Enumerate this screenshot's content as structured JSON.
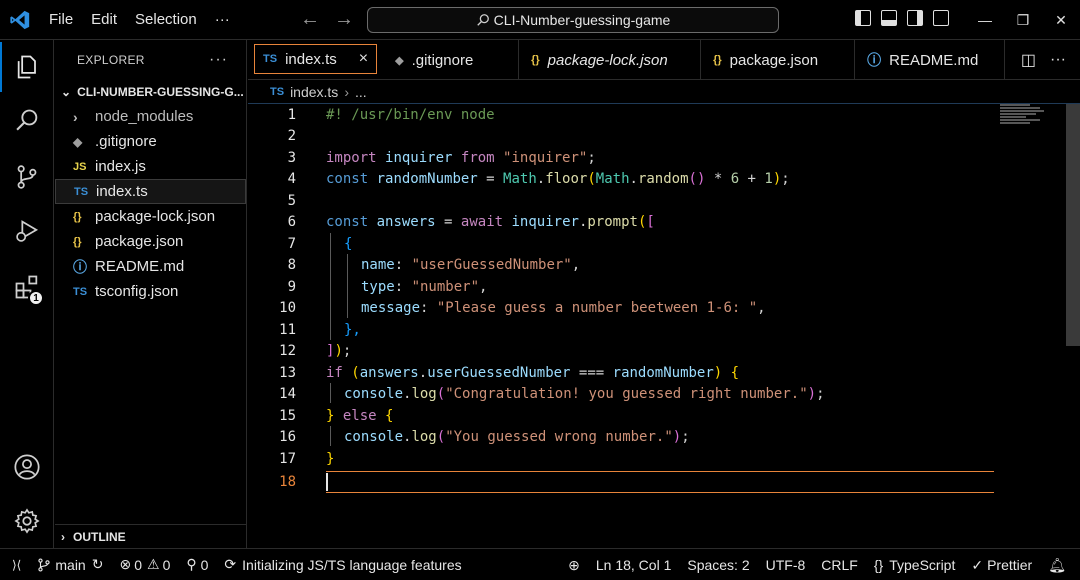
{
  "titlebar": {
    "menu": [
      "File",
      "Edit",
      "Selection",
      "···"
    ],
    "command_center": "CLI-Number-guessing-game"
  },
  "activity_bar": {
    "items": [
      "explorer-icon",
      "search-icon",
      "source-control-icon",
      "run-debug-icon",
      "extensions-icon"
    ],
    "extensions_badge": "1",
    "bottom": [
      "accounts-icon",
      "settings-gear-icon"
    ],
    "accent_color": "#0078d4"
  },
  "sidebar": {
    "title": "EXPLORER",
    "more": "···",
    "project": "CLI-NUMBER-GUESSING-G...",
    "items": [
      {
        "label": "node_modules",
        "icon": "›"
      },
      {
        "label": ".gitignore",
        "icon": "◆"
      },
      {
        "label": "index.js",
        "icon": "JS"
      },
      {
        "label": "index.ts",
        "icon": "TS"
      },
      {
        "label": "package-lock.json",
        "icon": "{}"
      },
      {
        "label": "package.json",
        "icon": "{}"
      },
      {
        "label": "README.md",
        "icon": "ⓘ"
      },
      {
        "label": "tsconfig.json",
        "icon": "TS"
      }
    ],
    "outline": "OUTLINE"
  },
  "tabs": [
    {
      "label": "index.ts",
      "icon": "TS",
      "close": "×"
    },
    {
      "label": ".gitignore",
      "icon": "◆"
    },
    {
      "label": "package-lock.json",
      "icon": "{}"
    },
    {
      "label": "package.json",
      "icon": "{}"
    },
    {
      "label": "README.md",
      "icon": "ⓘ"
    }
  ],
  "breadcrumb": {
    "icon": "TS",
    "file": "index.ts",
    "rest": "..."
  },
  "editor": {
    "current_line": 18,
    "accent": "#e8843a",
    "lines": [
      {
        "n": "1"
      },
      {
        "n": "2"
      },
      {
        "n": "3"
      },
      {
        "n": "4"
      },
      {
        "n": "5"
      },
      {
        "n": "6"
      },
      {
        "n": "7"
      },
      {
        "n": "8"
      },
      {
        "n": "9"
      },
      {
        "n": "10"
      },
      {
        "n": "11"
      },
      {
        "n": "12"
      },
      {
        "n": "13"
      },
      {
        "n": "14"
      },
      {
        "n": "15"
      },
      {
        "n": "16"
      },
      {
        "n": "17"
      },
      {
        "n": "18"
      }
    ],
    "code": {
      "l1": "#! /usr/bin/env node",
      "l3_kw": "import",
      "l3_var": "inquirer",
      "l3_from": "from",
      "l3_str": "\"inquirer\"",
      "l3_end": ";",
      "l4_kw": "const",
      "l4_var": "randomNumber",
      "l4_eq": " = ",
      "l4_cls1": "Math",
      "l4_fn1": "floor",
      "l4_cls2": "Math",
      "l4_fn2": "random",
      "l4_mul": " * ",
      "l4_n6": "6",
      "l4_plus": " + ",
      "l4_n1": "1",
      "l4_end": ";",
      "l6_kw": "const",
      "l6_var": "answers",
      "l6_eq": " = ",
      "l6_await": "await",
      "l6_obj": "inquirer",
      "l6_fn": "prompt",
      "l7": "{",
      "l8_key": "name",
      "l8_val": "\"userGuessedNumber\"",
      "l9_key": "type",
      "l9_val": "\"number\"",
      "l10_key": "message",
      "l10_val": "\"Please guess a number beetween 1-6: \"",
      "l11": "},",
      "l12_a": "]",
      "l12_b": ")",
      "l12_c": ";",
      "l13_if": "if",
      "l13_obj": "answers",
      "l13_prop": "userGuessedNumber",
      "l13_op": " === ",
      "l13_var": "randomNumber",
      "l14_obj": "console",
      "l14_fn": "log",
      "l14_str": "\"Congratulation! you guessed right number.\"",
      "l15_else": "else",
      "l16_obj": "console",
      "l16_fn": "log",
      "l16_str": "\"You guessed wrong number.\"",
      "l17": "}"
    }
  },
  "statusbar": {
    "remote": "⟩⟨",
    "branch": "main",
    "errors": "0",
    "warnings": "0",
    "ports": "0",
    "activity": "Initializing JS/TS language features",
    "position": "Ln 18, Col 1",
    "spaces": "Spaces: 2",
    "encoding": "UTF-8",
    "eol": "CRLF",
    "language": "TypeScript",
    "prettier": "Prettier"
  }
}
